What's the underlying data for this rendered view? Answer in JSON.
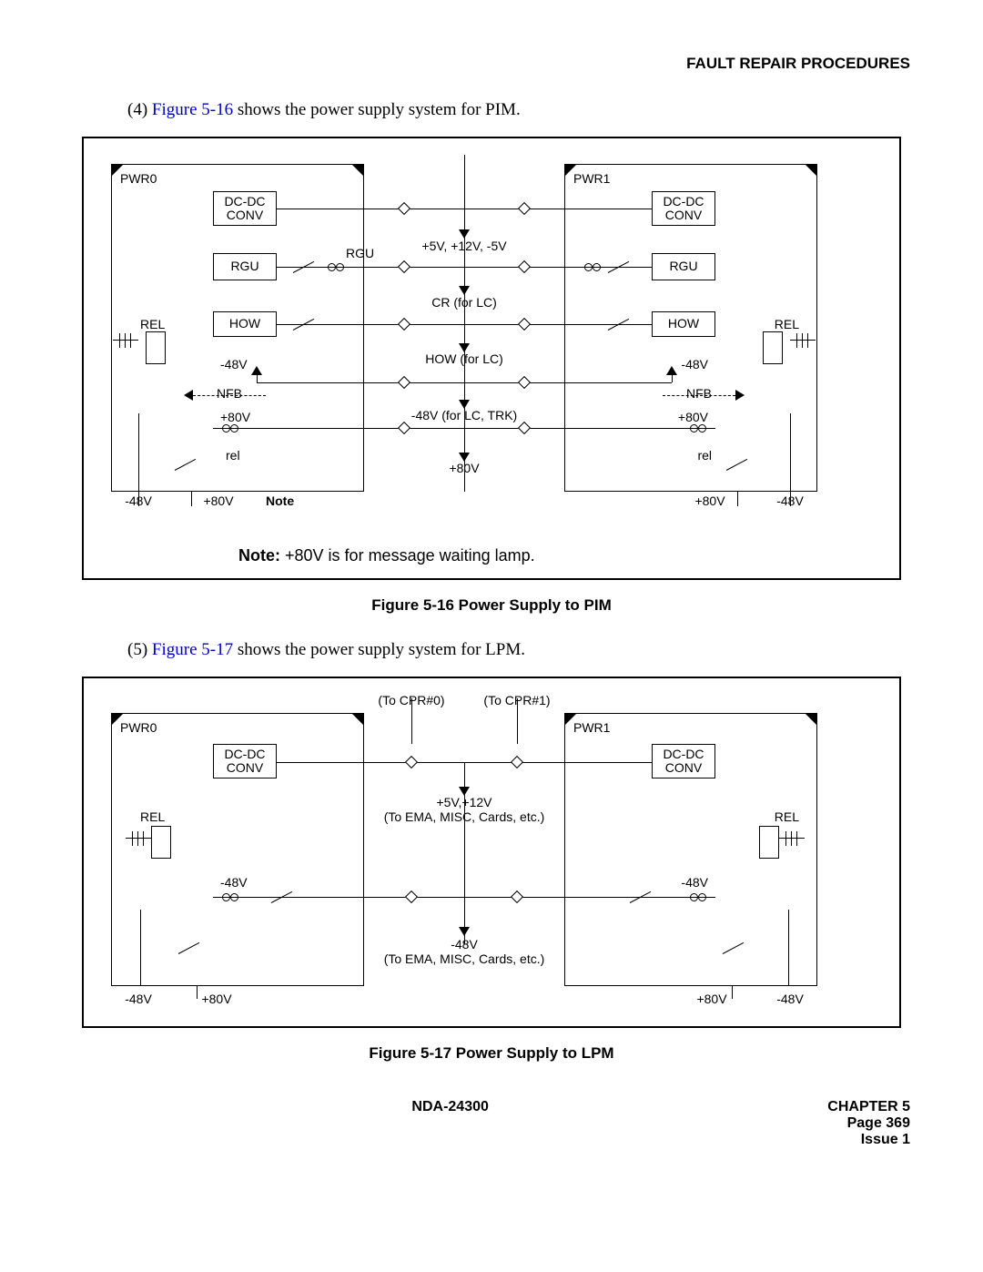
{
  "header": "FAULT REPAIR PROCEDURES",
  "para4": {
    "prefix": "(4)   ",
    "link": "Figure 5-16",
    "rest": " shows the power supply system for PIM."
  },
  "para5": {
    "prefix": "(5)   ",
    "link": "Figure 5-17",
    "rest": " shows the power supply system for LPM."
  },
  "fig1": {
    "caption": "Figure 5-16   Power Supply to PIM",
    "pwr0": "PWR0",
    "pwr1": "PWR1",
    "dcdc": "DC-DC\nCONV",
    "rgu": "RGU",
    "rgu_lbl": "RGU",
    "how": "HOW",
    "rel": "REL",
    "nfb": "NFB",
    "rel_small": "rel",
    "row1": "+5V, +12V, -5V",
    "row2": "CR (for LC)",
    "row3": "HOW (for LC)",
    "row4": "-48V (for LC, TRK)",
    "row5": "+80V",
    "neg48": "-48V",
    "pos80": "+80V",
    "note_word": "Note",
    "note": "Note:  +80V is for message waiting lamp."
  },
  "fig2": {
    "caption": "Figure 5-17   Power Supply to LPM",
    "pwr0": "PWR0",
    "pwr1": "PWR1",
    "toCpr0": "(To CPR#0)",
    "toCpr1": "(To CPR#1)",
    "dcdc": "DC-DC\nCONV",
    "row1a": "+5V,+12V",
    "row1b": "(To EMA, MISC, Cards, etc.)",
    "rel": "REL",
    "neg48": "-48V",
    "row2a": "-48V",
    "row2b": "(To EMA, MISC, Cards, etc.)",
    "pos80": "+80V"
  },
  "footer": {
    "doc": "NDA-24300",
    "chapter": "CHAPTER 5",
    "page": "Page 369",
    "issue": "Issue 1"
  }
}
